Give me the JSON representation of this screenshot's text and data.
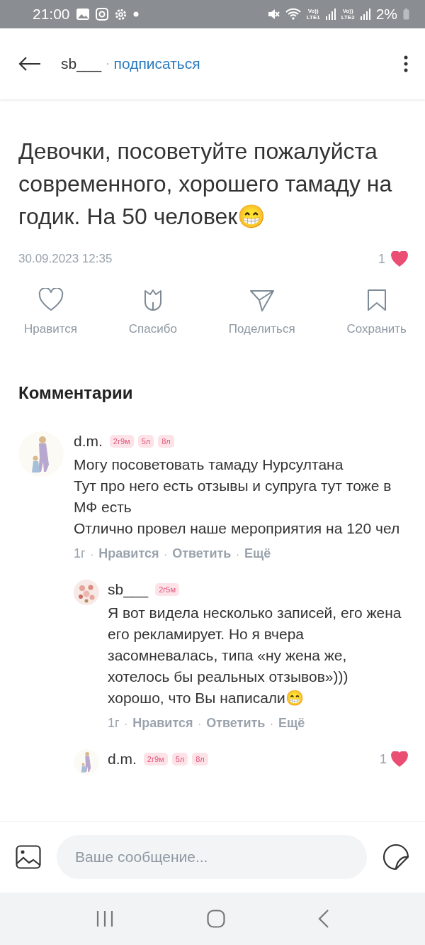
{
  "status_bar": {
    "time": "21:00",
    "network": [
      {
        "top": "Vo))",
        "bottom": "LTE1"
      },
      {
        "top": "Vo))",
        "bottom": "LTE2"
      }
    ],
    "battery": "2%"
  },
  "header": {
    "author": "sb___",
    "separator": "·",
    "follow": "подписаться"
  },
  "post": {
    "text": "Девочки, посоветуйте пожалуйста современного, хорошего тамаду на годик. На 50 человек😁",
    "date": "30.09.2023 12:35",
    "likes": "1",
    "liked": true
  },
  "actions": [
    {
      "kind": "like",
      "label": "Нравится"
    },
    {
      "kind": "thanks",
      "label": "Спасибо"
    },
    {
      "kind": "share",
      "label": "Поделиться"
    },
    {
      "kind": "save",
      "label": "Сохранить"
    }
  ],
  "comments_title": "Комментарии",
  "comments": [
    {
      "author": "d.m.",
      "reply": false,
      "badges": [
        "2г9м",
        "5л",
        "8л"
      ],
      "text": "Могу посоветовать тамаду Нурсултана\nТут  про него есть отзывы и супруга тут тоже в МФ есть\nОтлично провел наше мероприятия на 120 чел",
      "time": "1г",
      "separator": "·",
      "links": [
        "Нравится",
        "Ответить",
        "Ещё"
      ]
    },
    {
      "author": "sb___",
      "reply": true,
      "badges": [
        "2г5м"
      ],
      "text": "Я вот видела несколько записей, его жена его рекламирует. Но я вчера засомневалась, типа «ну жена же, хотелось бы реальных отзывов»))) хорошо, что Вы написали😁",
      "time": "1г",
      "separator": "·",
      "links": [
        "Нравится",
        "Ответить",
        "Ещё"
      ]
    },
    {
      "author": "d.m.",
      "reply": true,
      "badges": [
        "2г9м",
        "5л",
        "8л"
      ],
      "likes": "1",
      "liked": true
    }
  ],
  "composer": {
    "placeholder": "Ваше сообщение..."
  }
}
